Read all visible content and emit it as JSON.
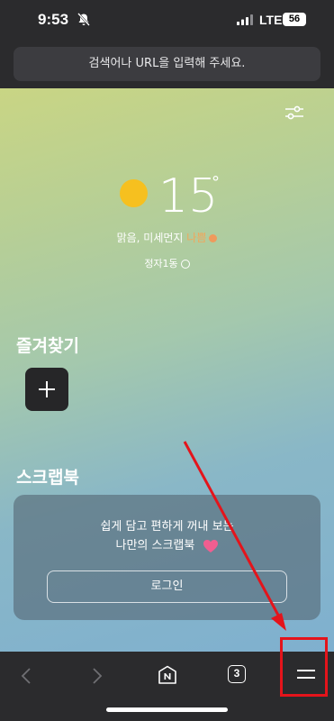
{
  "status_bar": {
    "time": "9:53",
    "network": "LTE",
    "battery": "56",
    "icons": [
      "bell-off-icon",
      "signal-icon",
      "battery-icon"
    ]
  },
  "address_bar": {
    "placeholder": "검색어나 URL을 입력해 주세요."
  },
  "weather": {
    "icon": "sun-icon",
    "temperature": "15",
    "degree_symbol": "°",
    "condition": "맑음, 미세먼지",
    "dust_level": "나쁨",
    "location": "정자1동"
  },
  "favorites": {
    "title": "즐겨찾기",
    "add_icon": "plus-icon"
  },
  "scrapbook": {
    "title": "스크랩북",
    "message_line1": "쉽게 담고 편하게 꺼내 보는",
    "message_line2": "나만의 스크랩북",
    "login_label": "로그인",
    "heart_color": "#f15e90"
  },
  "bottom_nav": {
    "tab_count": "3",
    "items": [
      "back-icon",
      "forward-icon",
      "naver-home-icon",
      "tabs-icon",
      "menu-icon"
    ]
  },
  "annotation": {
    "color": "#e4141b"
  }
}
